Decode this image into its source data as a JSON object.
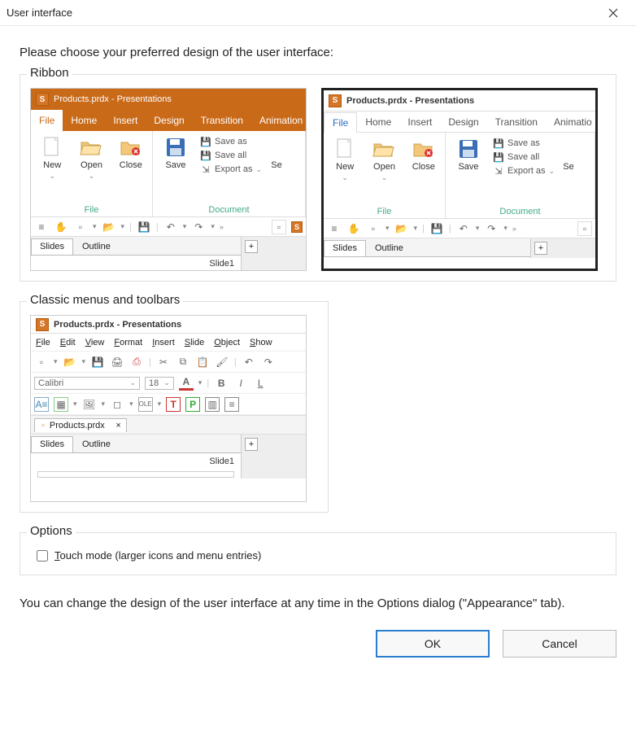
{
  "window": {
    "title": "User interface"
  },
  "instruction": "Please choose your preferred design of the user interface:",
  "sections": {
    "ribbon_label": "Ribbon",
    "classic_label": "Classic menus and toolbars",
    "options_label": "Options"
  },
  "ribbon_preview": {
    "app_title": "Products.prdx - Presentations",
    "tabs": [
      "File",
      "Home",
      "Insert",
      "Design",
      "Transition",
      "Animation"
    ],
    "tabs_short": [
      "File",
      "Home",
      "Insert",
      "Design",
      "Transition",
      "Animatio"
    ],
    "file_section": {
      "name": "File",
      "items": {
        "new": "New",
        "open": "Open",
        "close": "Close"
      }
    },
    "doc_section": {
      "name": "Document",
      "save": "Save",
      "save_as": "Save as",
      "save_all": "Save all",
      "export_as": "Export as",
      "se": "Se"
    },
    "slide_tabs": {
      "slides": "Slides",
      "outline": "Outline"
    },
    "slide_label": "Slide1"
  },
  "classic_preview": {
    "app_title": "Products.prdx - Presentations",
    "menus": [
      "File",
      "Edit",
      "View",
      "Format",
      "Insert",
      "Slide",
      "Object",
      "Show"
    ],
    "font_name": "Calibri",
    "font_size": "18",
    "doc_tab": "Products.prdx",
    "slide_tabs": {
      "slides": "Slides",
      "outline": "Outline"
    },
    "slide_label": "Slide1"
  },
  "options": {
    "touch_mode": "Touch mode (larger icons and menu entries)"
  },
  "footnote": "You can change the design of the user interface at any time in the Options dialog (\"Appearance\" tab).",
  "buttons": {
    "ok": "OK",
    "cancel": "Cancel"
  }
}
